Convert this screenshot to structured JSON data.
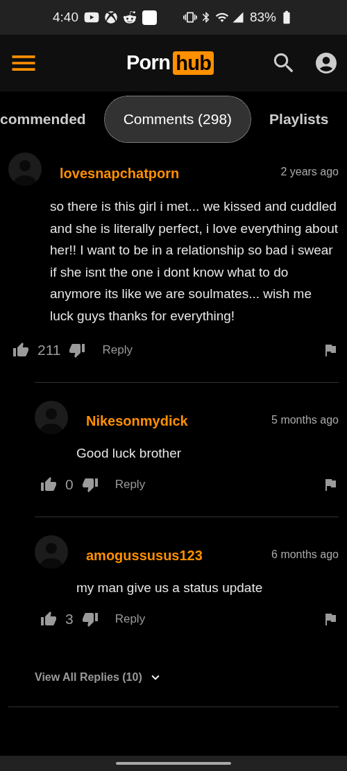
{
  "status_bar": {
    "time": "4:40",
    "battery": "83%"
  },
  "header": {
    "logo_left": "Porn",
    "logo_right": "hub"
  },
  "tabs": [
    {
      "label": "commended",
      "selected": false
    },
    {
      "label": "Comments (298)",
      "selected": true
    },
    {
      "label": "Playlists",
      "selected": false
    }
  ],
  "comment": {
    "author": "lovesnapchatporn",
    "time": "2 years ago",
    "text": "so there is this girl i met... we kissed and cuddled and she is literally perfect, i love everything about her!! I want to be in a relationship so bad i swear if she isnt the one i dont know what to do anymore its like we are soulmates... wish me luck guys thanks for everything!",
    "likes": "211",
    "reply": "Reply",
    "replies": [
      {
        "author": "Nikesonmydick",
        "time": "5 months ago",
        "text": "Good luck brother",
        "likes": "0",
        "reply": "Reply"
      },
      {
        "author": "amogussusus123",
        "time": "6 months ago",
        "text": "my man give us a status update",
        "likes": "3",
        "reply": "Reply"
      }
    ],
    "view_all": "View All Replies (10)"
  }
}
